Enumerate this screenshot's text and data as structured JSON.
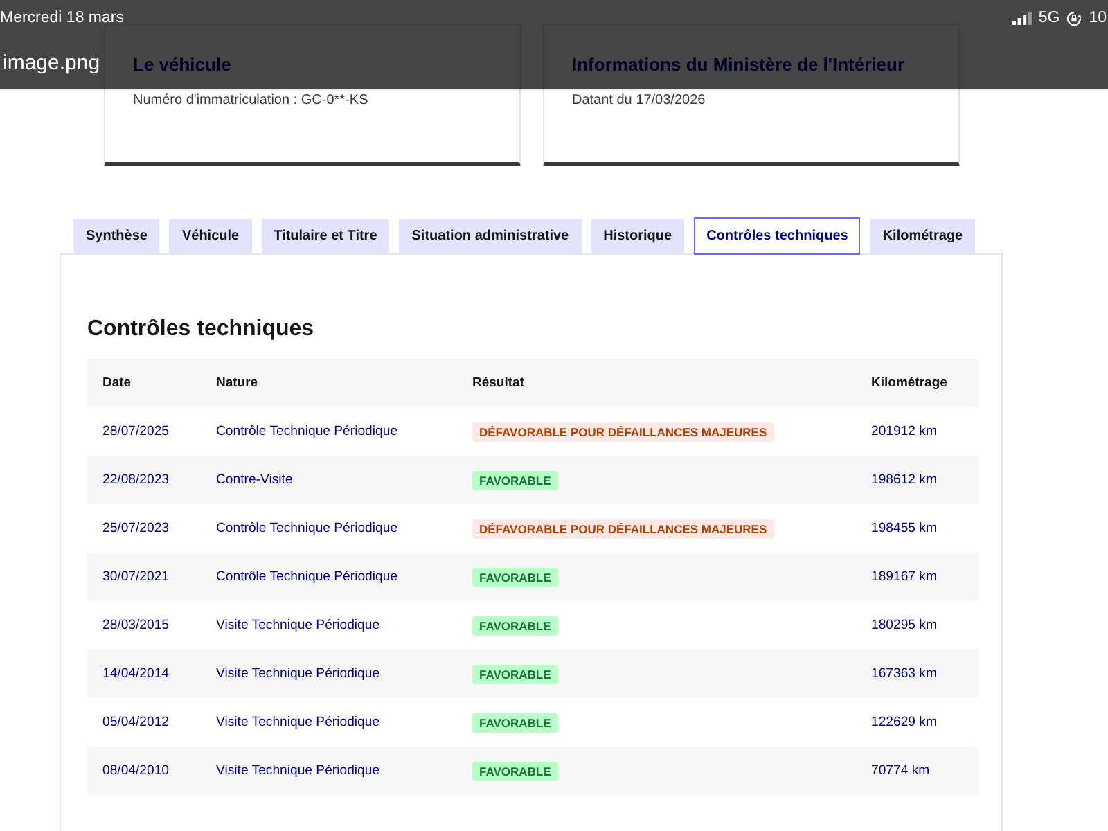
{
  "status_bar": {
    "date": "Mercredi 18 mars",
    "network": "5G",
    "battery": "10"
  },
  "viewer": {
    "title": "image.png"
  },
  "cards": [
    {
      "title": "Le véhicule",
      "subtitle": "Numéro d'immatriculation : GC-0**-KS"
    },
    {
      "title": "Informations du Ministère de l'Intérieur",
      "subtitle": "Datant du 17/03/2026"
    }
  ],
  "tabs": [
    {
      "label": "Synthèse",
      "selected": false
    },
    {
      "label": "Véhicule",
      "selected": false
    },
    {
      "label": "Titulaire et Titre",
      "selected": false
    },
    {
      "label": "Situation administrative",
      "selected": false
    },
    {
      "label": "Historique",
      "selected": false
    },
    {
      "label": "Contrôles techniques",
      "selected": true
    },
    {
      "label": "Kilométrage",
      "selected": false
    }
  ],
  "section": {
    "title": "Contrôles techniques",
    "table": {
      "columns": [
        "Date",
        "Nature",
        "Résultat",
        "Kilométrage"
      ],
      "rows": [
        {
          "date": "28/07/2025",
          "nature": "Contrôle Technique Périodique",
          "result": {
            "label": "DÉFAVORABLE POUR DÉFAILLANCES MAJEURES",
            "kind": "error"
          },
          "mileage": "201912 km"
        },
        {
          "date": "22/08/2023",
          "nature": "Contre-Visite",
          "result": {
            "label": "FAVORABLE",
            "kind": "success"
          },
          "mileage": "198612 km"
        },
        {
          "date": "25/07/2023",
          "nature": "Contrôle Technique Périodique",
          "result": {
            "label": "DÉFAVORABLE POUR DÉFAILLANCES MAJEURES",
            "kind": "error"
          },
          "mileage": "198455 km"
        },
        {
          "date": "30/07/2021",
          "nature": "Contrôle Technique Périodique",
          "result": {
            "label": "FAVORABLE",
            "kind": "success"
          },
          "mileage": "189167 km"
        },
        {
          "date": "28/03/2015",
          "nature": "Visite Technique Périodique",
          "result": {
            "label": "FAVORABLE",
            "kind": "success"
          },
          "mileage": "180295 km"
        },
        {
          "date": "14/04/2014",
          "nature": "Visite Technique Périodique",
          "result": {
            "label": "FAVORABLE",
            "kind": "success"
          },
          "mileage": "167363 km"
        },
        {
          "date": "05/04/2012",
          "nature": "Visite Technique Périodique",
          "result": {
            "label": "FAVORABLE",
            "kind": "success"
          },
          "mileage": "122629 km"
        },
        {
          "date": "08/04/2010",
          "nature": "Visite Technique Périodique",
          "result": {
            "label": "FAVORABLE",
            "kind": "success"
          },
          "mileage": "70774 km"
        }
      ]
    }
  }
}
